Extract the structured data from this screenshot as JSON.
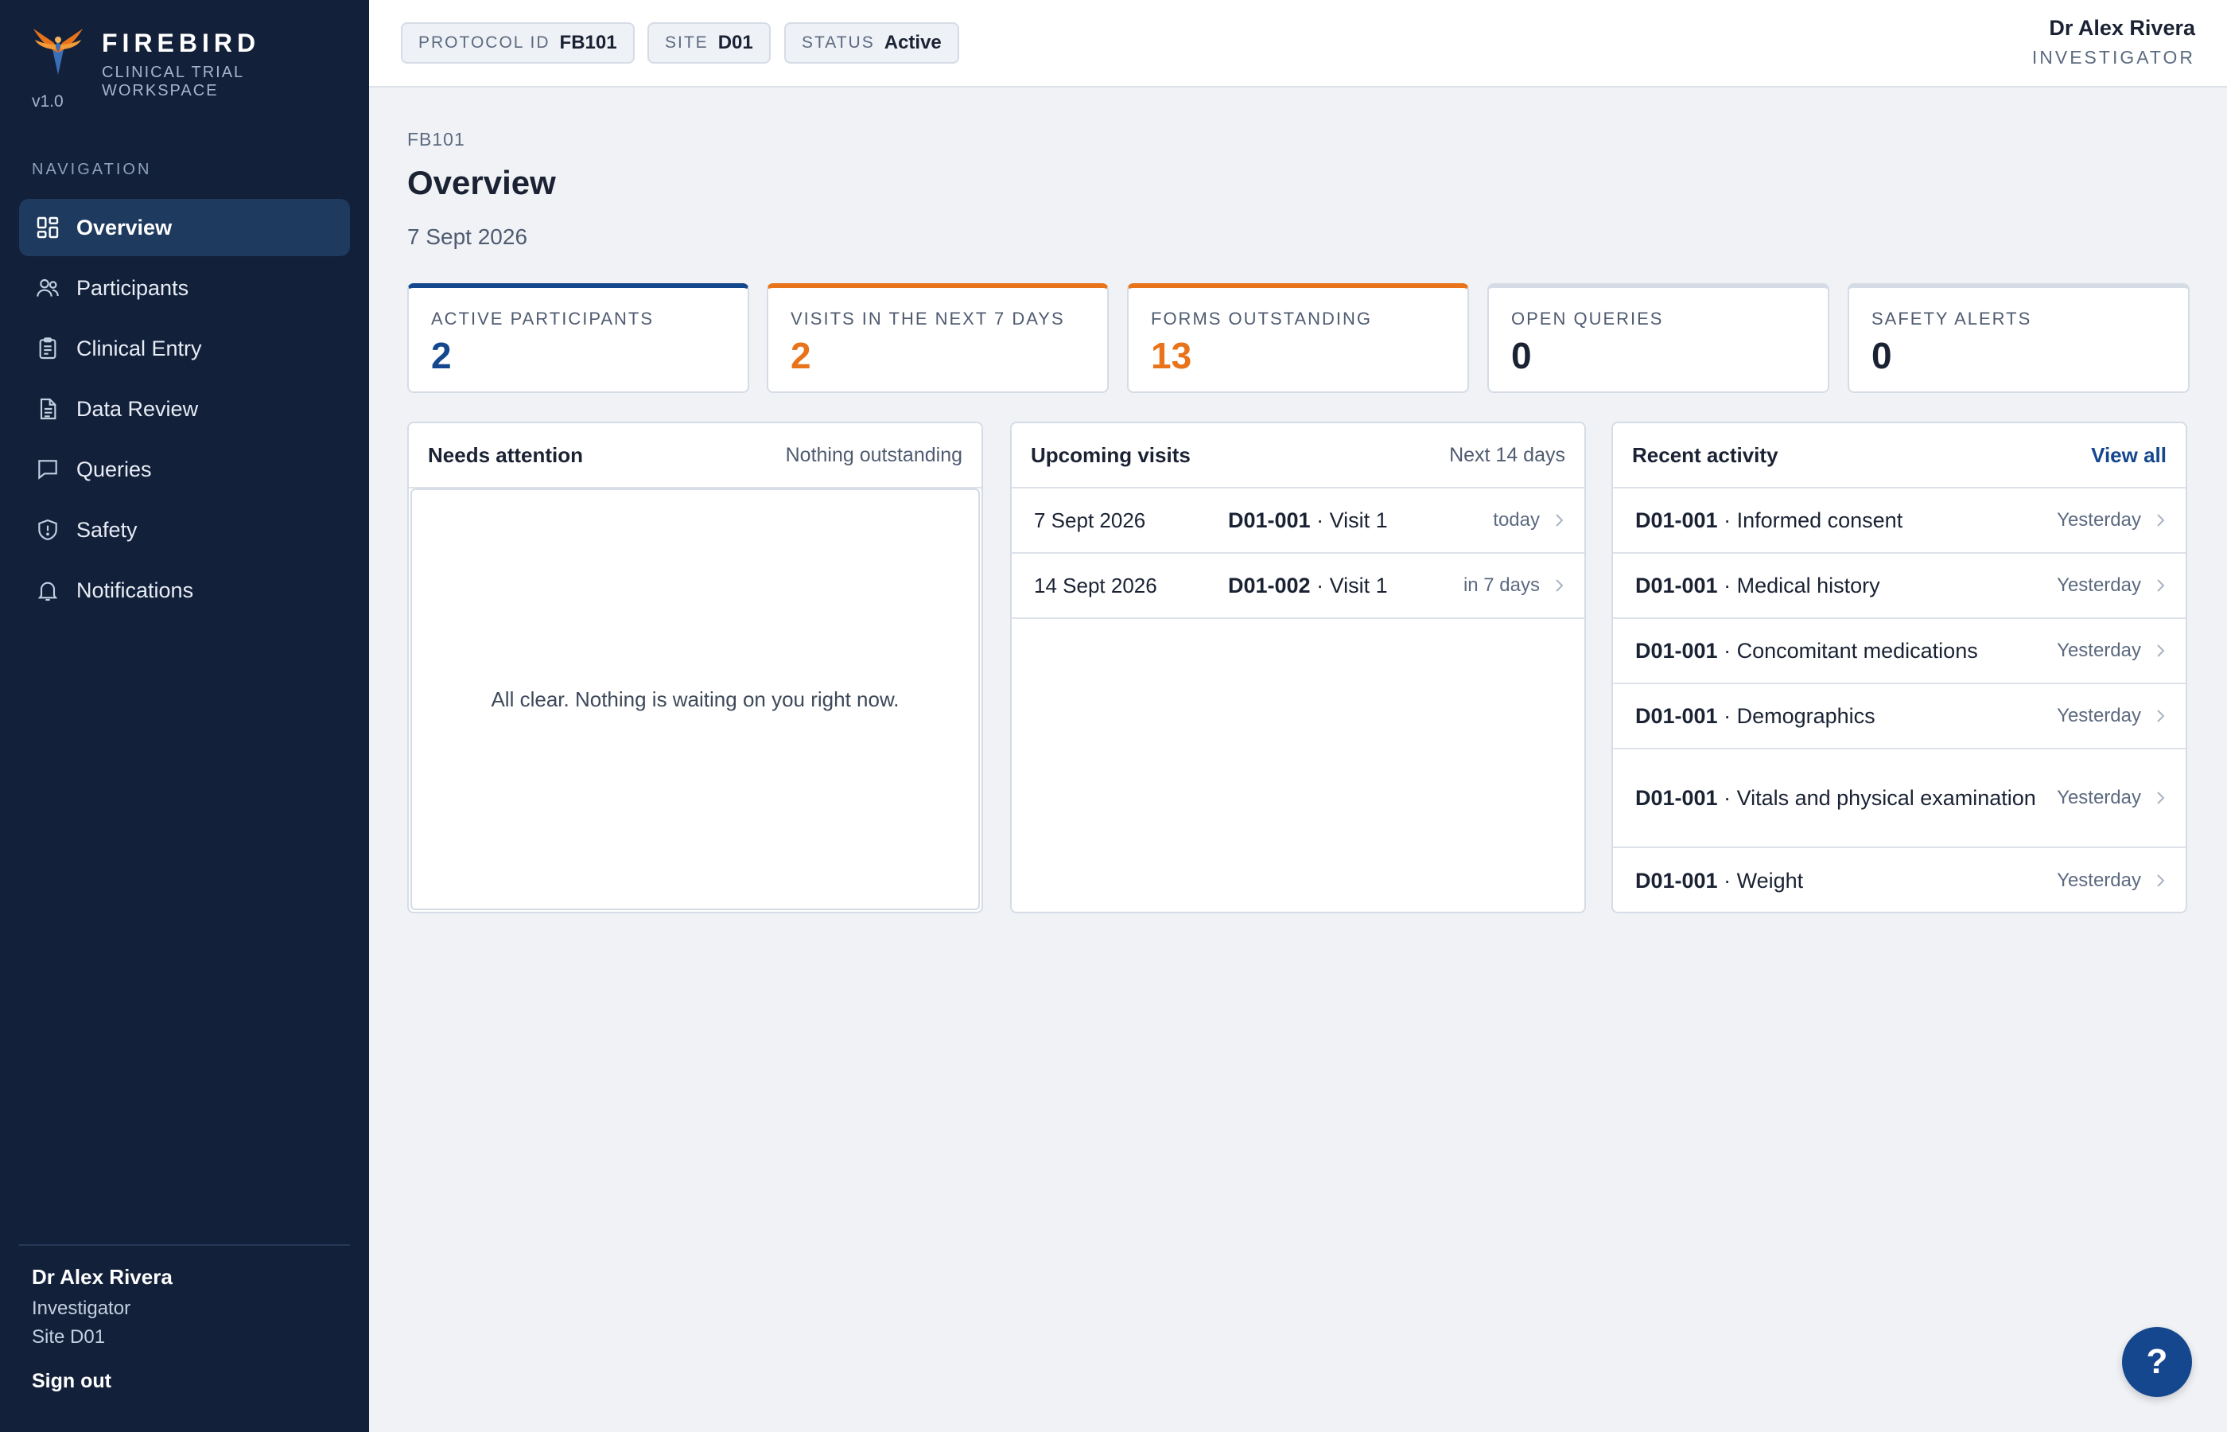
{
  "brand": {
    "name": "FIREBIRD",
    "subtitle": "CLINICAL TRIAL WORKSPACE",
    "version": "v1.0"
  },
  "sidebar": {
    "heading": "NAVIGATION",
    "items": [
      {
        "label": "Overview",
        "icon": "dashboard-icon",
        "active": true
      },
      {
        "label": "Participants",
        "icon": "users-icon"
      },
      {
        "label": "Clinical Entry",
        "icon": "clipboard-icon"
      },
      {
        "label": "Data Review",
        "icon": "document-icon"
      },
      {
        "label": "Queries",
        "icon": "chat-icon"
      },
      {
        "label": "Safety",
        "icon": "shield-icon"
      },
      {
        "label": "Notifications",
        "icon": "bell-icon"
      }
    ],
    "user": {
      "name": "Dr Alex Rivera",
      "role": "Investigator",
      "site": "Site D01"
    },
    "sign_out": "Sign out"
  },
  "topbar": {
    "pills": [
      {
        "key": "PROTOCOL ID",
        "value": "FB101"
      },
      {
        "key": "SITE",
        "value": "D01"
      },
      {
        "key": "STATUS",
        "value": "Active"
      }
    ],
    "user": {
      "name": "Dr Alex Rivera",
      "role": "INVESTIGATOR"
    }
  },
  "page": {
    "breadcrumb": "FB101",
    "title": "Overview",
    "date": "7 Sept 2026"
  },
  "stats": [
    {
      "label": "ACTIVE PARTICIPANTS",
      "value": "2",
      "accent": "#15478f"
    },
    {
      "label": "VISITS IN THE NEXT 7 DAYS",
      "value": "2",
      "accent": "#e8731a"
    },
    {
      "label": "FORMS OUTSTANDING",
      "value": "13",
      "accent": "#e8731a"
    },
    {
      "label": "OPEN QUERIES",
      "value": "0"
    },
    {
      "label": "SAFETY ALERTS",
      "value": "0"
    }
  ],
  "attention": {
    "title": "Needs attention",
    "meta": "Nothing outstanding",
    "empty": "All clear. Nothing is waiting on you right now."
  },
  "visits": {
    "title": "Upcoming visits",
    "meta": "Next 14 days",
    "rows": [
      {
        "date": "7 Sept 2026",
        "participant": "D01-001",
        "visit": " · Visit 1",
        "when": "today"
      },
      {
        "date": "14 Sept 2026",
        "participant": "D01-002",
        "visit": " · Visit 1",
        "when": "in 7 days"
      }
    ]
  },
  "activity": {
    "title": "Recent activity",
    "link": "View all",
    "rows": [
      {
        "participant": "D01-001",
        "form": " · Informed consent",
        "when": "Yesterday"
      },
      {
        "participant": "D01-001",
        "form": " · Medical history",
        "when": "Yesterday"
      },
      {
        "participant": "D01-001",
        "form": " · Concomitant medications",
        "when": "Yesterday"
      },
      {
        "participant": "D01-001",
        "form": " · Demographics",
        "when": "Yesterday"
      },
      {
        "participant": "D01-001",
        "form": " · Vitals and physical examination",
        "when": "Yesterday"
      },
      {
        "participant": "D01-001",
        "form": " · Weight",
        "when": "Yesterday"
      }
    ]
  },
  "help": {
    "label": "?"
  },
  "colors": {
    "sidebar_bg": "#12203a",
    "accent_blue": "#15478f",
    "accent_orange": "#e8731a"
  }
}
